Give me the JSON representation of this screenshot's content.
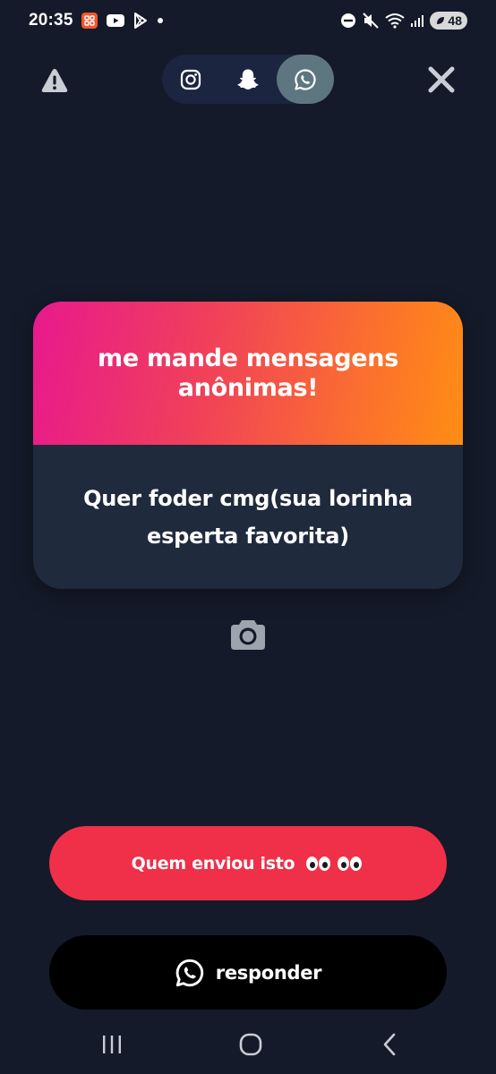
{
  "status_bar": {
    "time": "20:35",
    "notification_icons": [
      "app-notification-icon",
      "youtube-icon",
      "play-store-icon",
      "dot-icon"
    ],
    "system_icons": [
      "do-not-disturb-icon",
      "mute-icon",
      "wifi-icon",
      "signal-icon"
    ],
    "battery": "48"
  },
  "top_bar": {
    "share_tabs": [
      {
        "name": "instagram",
        "icon": "instagram-icon",
        "selected": false
      },
      {
        "name": "snapchat",
        "icon": "snapchat-icon",
        "selected": false
      },
      {
        "name": "whatsapp",
        "icon": "whatsapp-icon",
        "selected": true
      }
    ]
  },
  "card": {
    "title": "me mande mensagens anônimas!",
    "message": "Quer foder cmg(sua lorinha esperta favorita)"
  },
  "actions": {
    "who_sent_label": "Quem enviou isto",
    "who_sent_emoji": "👀👀",
    "reply_label": "responder"
  },
  "colors": {
    "background": "#141a29",
    "card_body": "#1f2a3d",
    "gradient_start": "#e8198d",
    "gradient_end": "#ff8d14",
    "primary_button": "#ef3048",
    "reply_button": "#000000",
    "selected_tab": "#5e767f"
  }
}
